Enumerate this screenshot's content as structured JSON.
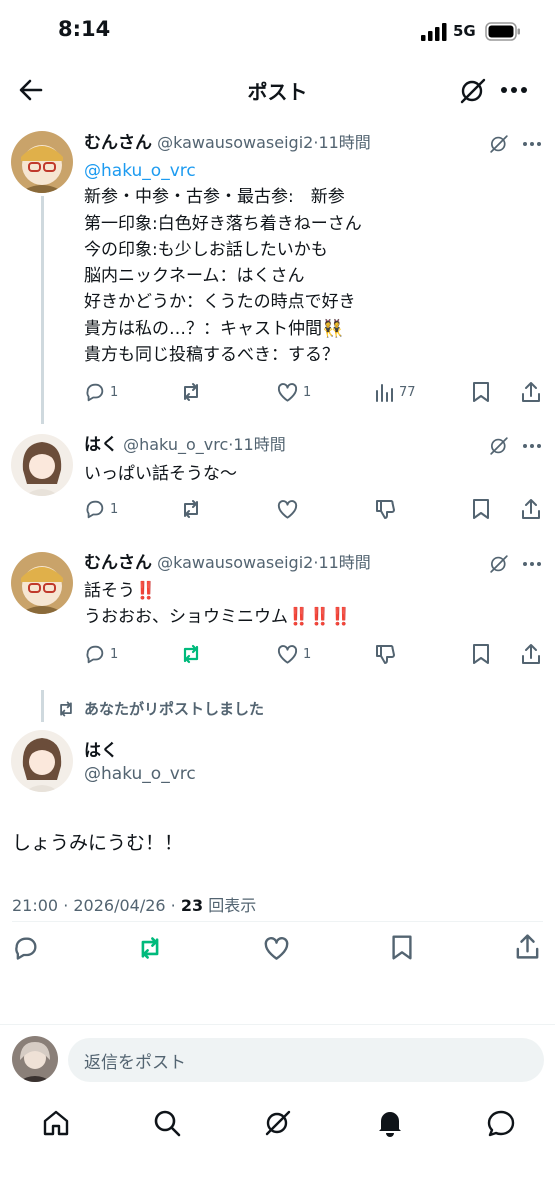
{
  "status_bar": {
    "time": "8:14",
    "network": "5G"
  },
  "header": {
    "title": "ポスト"
  },
  "tweets": [
    {
      "name": "むんさん",
      "handle": "@kawausowaseigi2",
      "time": "11時間",
      "lines": [
        "@haku_o_vrc",
        "新参・中参・古参・最古参:　新参",
        "第一印象:白色好き落ち着きねーさん",
        "今の印象:も少しお話したいかも",
        "脳内ニックネーム：はくさん",
        "好きかどうか：くうたの時点で好き",
        "貴方は私の…？：キャスト仲間👯",
        "貴方も同じ投稿するべき：する？"
      ],
      "replies": "1",
      "likes": "1",
      "views": "77"
    },
    {
      "name": "はく",
      "handle": "@haku_o_vrc",
      "time": "11時間",
      "lines": [
        "いっぱい話そうな〜"
      ],
      "replies": "1"
    },
    {
      "name": "むんさん",
      "handle": "@kawausowaseigi2",
      "time": "11時間",
      "lines": [
        "話そう‼️",
        "うおおお、ショウミニウム‼️‼️‼️"
      ],
      "replies": "1",
      "likes": "1"
    }
  ],
  "main_post": {
    "repost_notice": "あなたがリポストしました",
    "name": "はく",
    "handle": "@haku_o_vrc",
    "text": "しょうみにうむ！！",
    "timestamp": "21:00 · 2026/04/26 · ",
    "view_count": "23",
    "view_label": "回表示"
  },
  "reply_input": {
    "placeholder": "返信をポスト"
  },
  "colors": {
    "accent": "#1d9bf0",
    "repost_green": "#00ba7c",
    "gray": "#536471",
    "line": "#cfd9de"
  },
  "icons": [
    "back-arrow-icon",
    "grok-icon",
    "more-icon",
    "reply-icon",
    "repost-icon",
    "like-icon",
    "views-icon",
    "bookmark-icon",
    "share-icon",
    "dislike-icon",
    "home-icon",
    "search-icon",
    "bell-icon",
    "messages-icon"
  ]
}
